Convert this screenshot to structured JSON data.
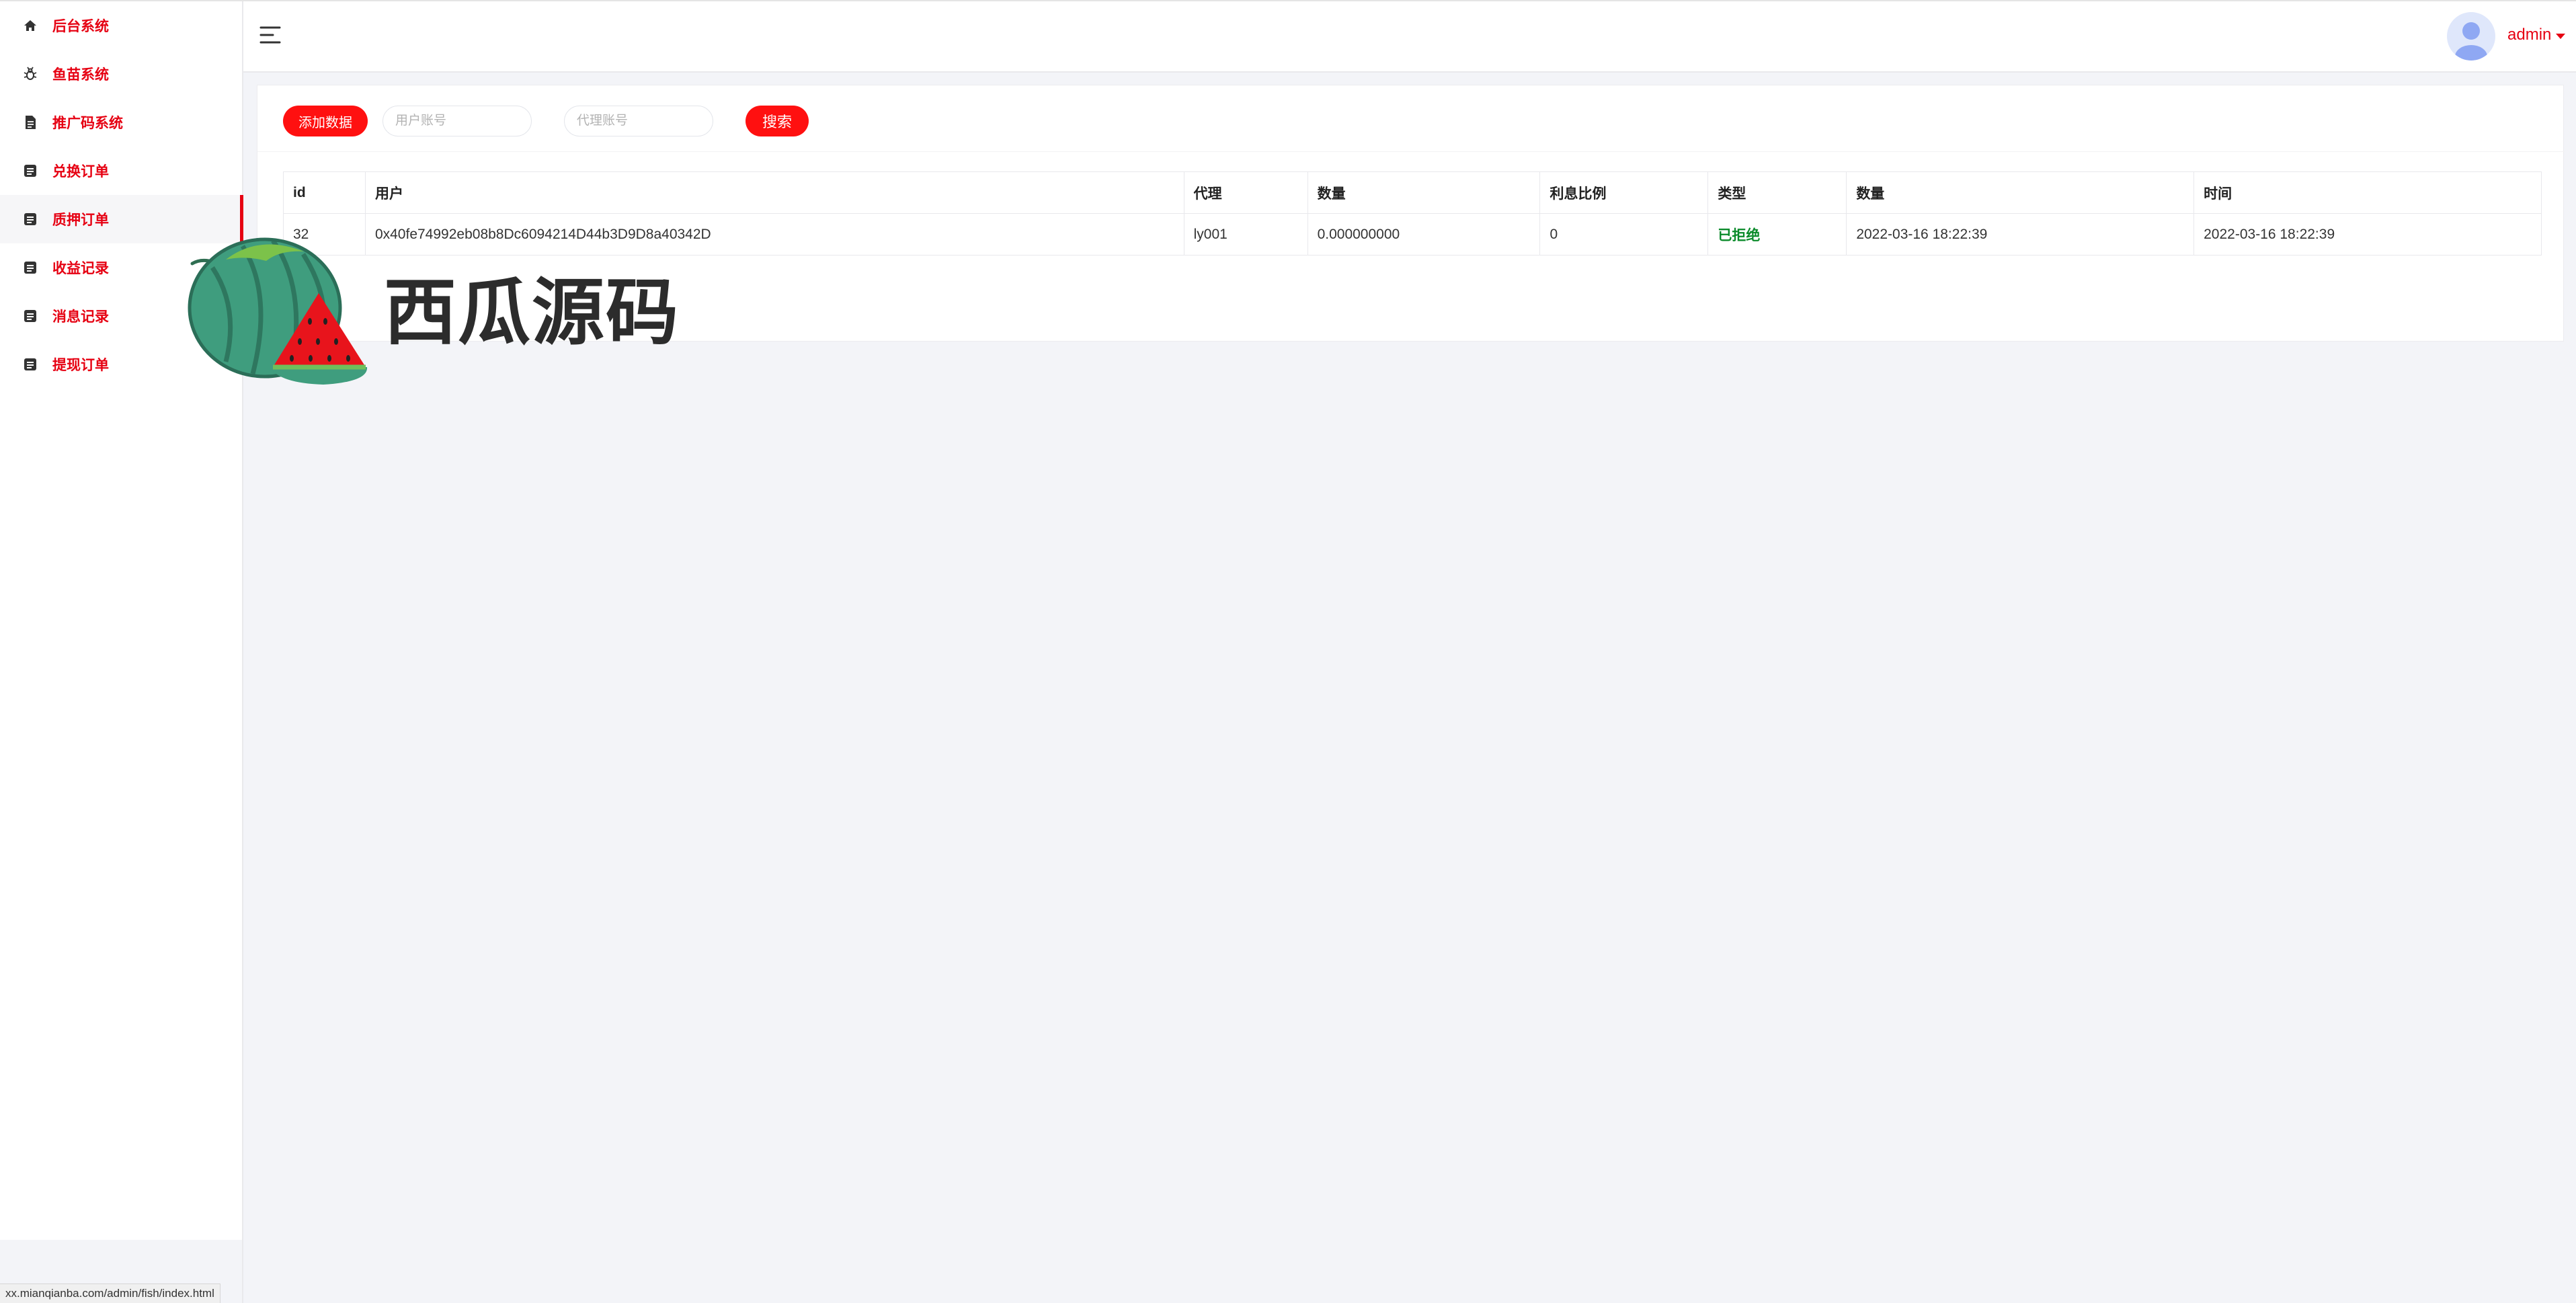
{
  "sidebar": {
    "items": [
      {
        "label": "后台系统",
        "icon": "home-icon"
      },
      {
        "label": "鱼苗系统",
        "icon": "bug-icon"
      },
      {
        "label": "推广码系统",
        "icon": "document-icon"
      },
      {
        "label": "兑换订单",
        "icon": "list-icon"
      },
      {
        "label": "质押订单",
        "icon": "list-icon",
        "active": true
      },
      {
        "label": "收益记录",
        "icon": "list-icon"
      },
      {
        "label": "消息记录",
        "icon": "list-icon"
      },
      {
        "label": "提现订单",
        "icon": "list-icon"
      }
    ]
  },
  "header": {
    "user_name": "admin"
  },
  "toolbar": {
    "add_label": "添加数据",
    "user_placeholder": "用户账号",
    "agent_placeholder": "代理账号",
    "search_label": "搜索"
  },
  "table": {
    "columns": [
      "id",
      "用户",
      "代理",
      "数量",
      "利息比例",
      "类型",
      "数量",
      "时间"
    ],
    "rows": [
      {
        "id": "32",
        "user": "0x40fe74992eb08b8Dc6094214D44b3D9D8a40342D",
        "agent": "ly001",
        "amount": "0.000000000",
        "rate": "0",
        "type": "已拒绝",
        "amount2": "2022-03-16 18:22:39",
        "time": "2022-03-16 18:22:39"
      }
    ]
  },
  "watermark": {
    "text": "西瓜源码"
  },
  "statusbar": {
    "url": "xx.mianqianba.com/admin/fish/index.html"
  },
  "colors": {
    "accent": "#e60012",
    "button": "#ff1010",
    "rejected": "#0a8a2a"
  }
}
